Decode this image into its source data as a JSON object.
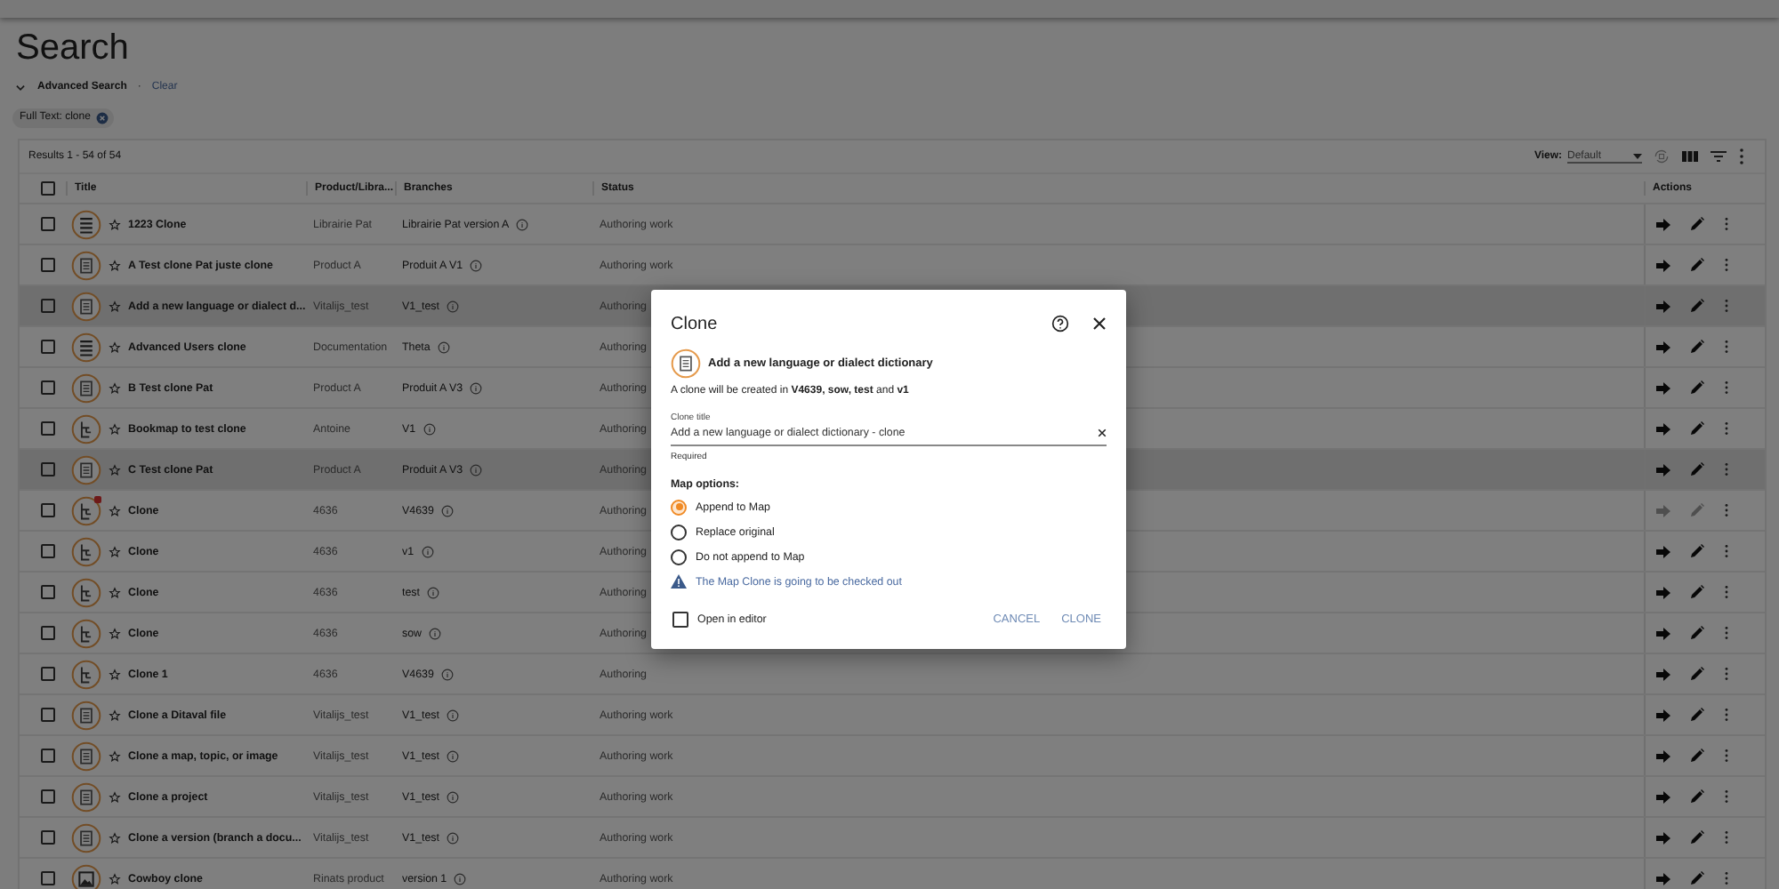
{
  "page_title": "Search",
  "advanced_search": {
    "label": "Advanced Search",
    "expanded": true,
    "separator": "·",
    "clear_link": "Clear"
  },
  "chips": [
    {
      "label": "Full Text: clone"
    }
  ],
  "results": {
    "summary": "Results 1 - 54 of 54",
    "view_label": "View:",
    "view_value": "Default"
  },
  "table": {
    "select_all_checked": false,
    "columns": [
      "Title",
      "Product/Libra...",
      "Branches",
      "Status",
      "Actions"
    ],
    "rows": [
      {
        "kind": "map",
        "title": "1223 Clone",
        "product": "Librairie Pat",
        "branch": "Librairie Pat version A",
        "status": "Authoring work",
        "checked": false,
        "selected": false,
        "badge": false,
        "actions_disabled": false
      },
      {
        "kind": "topic",
        "title": "A Test clone Pat juste clone",
        "product": "Product A",
        "branch": "Produit A V1",
        "status": "Authoring work",
        "checked": false,
        "selected": false,
        "badge": false,
        "actions_disabled": false
      },
      {
        "kind": "topic",
        "title": "Add a new language or dialect d...",
        "product": "Vitalijs_test",
        "branch": "V1_test",
        "status": "Authoring",
        "checked": false,
        "selected": true,
        "badge": false,
        "actions_disabled": false
      },
      {
        "kind": "map",
        "title": "Advanced Users clone",
        "product": "Documentation",
        "branch": "Theta",
        "status": "Authoring",
        "checked": false,
        "selected": false,
        "badge": false,
        "actions_disabled": false
      },
      {
        "kind": "topic",
        "title": "B Test clone Pat",
        "product": "Product A",
        "branch": "Produit A V3",
        "status": "Authoring",
        "checked": false,
        "selected": false,
        "badge": false,
        "actions_disabled": false
      },
      {
        "kind": "bookmap",
        "title": "Bookmap to test clone",
        "product": "Antoine",
        "branch": "V1",
        "status": "Authoring",
        "checked": false,
        "selected": false,
        "badge": false,
        "actions_disabled": false
      },
      {
        "kind": "topic",
        "title": "C Test clone Pat",
        "product": "Product A",
        "branch": "Produit A V3",
        "status": "Authoring",
        "checked": false,
        "selected": true,
        "badge": false,
        "actions_disabled": false
      },
      {
        "kind": "bookmap",
        "title": "Clone",
        "product": "4636",
        "branch": "V4639",
        "status": "Authoring",
        "checked": false,
        "selected": false,
        "badge": true,
        "actions_disabled": true
      },
      {
        "kind": "bookmap",
        "title": "Clone",
        "product": "4636",
        "branch": "v1",
        "status": "Authoring",
        "checked": false,
        "selected": false,
        "badge": false,
        "actions_disabled": false
      },
      {
        "kind": "bookmap",
        "title": "Clone",
        "product": "4636",
        "branch": "test",
        "status": "Authoring",
        "checked": false,
        "selected": false,
        "badge": false,
        "actions_disabled": false
      },
      {
        "kind": "bookmap",
        "title": "Clone",
        "product": "4636",
        "branch": "sow",
        "status": "Authoring",
        "checked": false,
        "selected": false,
        "badge": false,
        "actions_disabled": false
      },
      {
        "kind": "bookmap",
        "title": "Clone 1",
        "product": "4636",
        "branch": "V4639",
        "status": "Authoring",
        "checked": false,
        "selected": false,
        "badge": false,
        "actions_disabled": false
      },
      {
        "kind": "topic",
        "title": "Clone a Ditaval file",
        "product": "Vitalijs_test",
        "branch": "V1_test",
        "status": "Authoring work",
        "checked": false,
        "selected": false,
        "badge": false,
        "actions_disabled": false
      },
      {
        "kind": "topic",
        "title": "Clone a map, topic, or image",
        "product": "Vitalijs_test",
        "branch": "V1_test",
        "status": "Authoring work",
        "checked": false,
        "selected": false,
        "badge": false,
        "actions_disabled": false
      },
      {
        "kind": "topic",
        "title": "Clone a project",
        "product": "Vitalijs_test",
        "branch": "V1_test",
        "status": "Authoring work",
        "checked": false,
        "selected": false,
        "badge": false,
        "actions_disabled": false
      },
      {
        "kind": "topic",
        "title": "Clone a version (branch a docu...",
        "product": "Vitalijs_test",
        "branch": "V1_test",
        "status": "Authoring work",
        "checked": false,
        "selected": false,
        "badge": false,
        "actions_disabled": false
      },
      {
        "kind": "image",
        "title": "Cowboy clone",
        "product": "Rinats product",
        "branch": "version 1",
        "status": "Authoring work",
        "checked": false,
        "selected": false,
        "badge": false,
        "actions_disabled": false
      }
    ]
  },
  "dialog": {
    "title": "Clone",
    "item_title": "Add a new language or dialect dictionary",
    "info": "A clone will be created in **V4639, sow, test** and **v1**",
    "field": {
      "label": "Clone title",
      "value": "Add a new language or dialect dictionary - clone",
      "hint": "Required"
    },
    "options_label": "Map options:",
    "options": [
      {
        "label": "Append to Map",
        "selected": true
      },
      {
        "label": "Replace original",
        "selected": false
      },
      {
        "label": "Do not append to Map",
        "selected": false
      }
    ],
    "warning": "The Map Clone is going to be checked out",
    "open_in_editor": {
      "label": "Open in editor",
      "checked": false
    },
    "buttons": [
      "CANCEL",
      "CLONE"
    ]
  }
}
